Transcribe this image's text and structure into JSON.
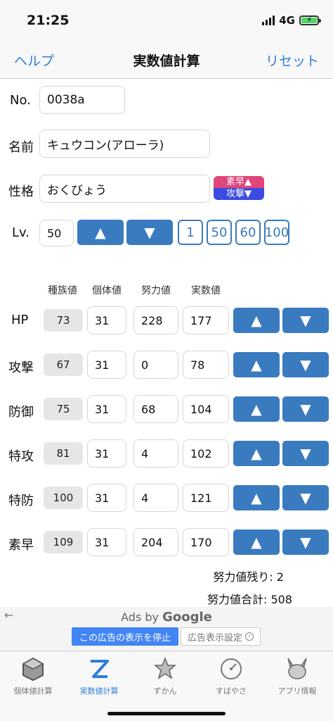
{
  "status": {
    "time": "21:25",
    "network": "4G"
  },
  "nav": {
    "left": "ヘルプ",
    "title": "実数値計算",
    "right": "リセット"
  },
  "form": {
    "no_label": "No.",
    "no_value": "0038a",
    "name_label": "名前",
    "name_value": "キュウコン(アローラ)",
    "nature_label": "性格",
    "nature_value": "おくびょう",
    "nature_up": "素早▲",
    "nature_down": "攻撃▼",
    "lv_label": "Lv.",
    "lv_value": "50",
    "lv_up": "▲",
    "lv_down": "▼",
    "lv_presets": [
      "1",
      "50",
      "60",
      "100"
    ]
  },
  "columns": [
    "種族値",
    "個体値",
    "努力値",
    "実数値"
  ],
  "stats": [
    {
      "name": "HP",
      "base": "73",
      "iv": "31",
      "ev": "228",
      "actual": "177"
    },
    {
      "name": "攻撃",
      "base": "67",
      "iv": "31",
      "ev": "0",
      "actual": "78"
    },
    {
      "name": "防御",
      "base": "75",
      "iv": "31",
      "ev": "68",
      "actual": "104"
    },
    {
      "name": "特攻",
      "base": "81",
      "iv": "31",
      "ev": "4",
      "actual": "102"
    },
    {
      "name": "特防",
      "base": "100",
      "iv": "31",
      "ev": "4",
      "actual": "121"
    },
    {
      "name": "素早",
      "base": "109",
      "iv": "31",
      "ev": "204",
      "actual": "170"
    }
  ],
  "stat_up": "▲",
  "stat_down": "▼",
  "summary": {
    "ev_remaining": "努力値残り: 2",
    "ev_total": "努力値合計: 508"
  },
  "ads": {
    "back": "←",
    "ads_by": "Ads by",
    "google": "Google",
    "stop": "この広告の表示を停止",
    "settings": "広告表示設定",
    "info": "i"
  },
  "tabs": [
    {
      "label": "個体値計算",
      "icon": "hexagon-icon",
      "active": false
    },
    {
      "label": "実数値計算",
      "icon": "z-ruler-icon",
      "active": true
    },
    {
      "label": "ずかん",
      "icon": "monster-icon",
      "active": false
    },
    {
      "label": "すばやさ",
      "icon": "speedometer-icon",
      "active": false
    },
    {
      "label": "アプリ情報",
      "icon": "pikachu-icon",
      "active": false
    }
  ],
  "colors": {
    "accent": "#2f7fd6",
    "button": "#3a7bbf",
    "nature_up": "#e0457b",
    "nature_down": "#3b4ce0"
  }
}
